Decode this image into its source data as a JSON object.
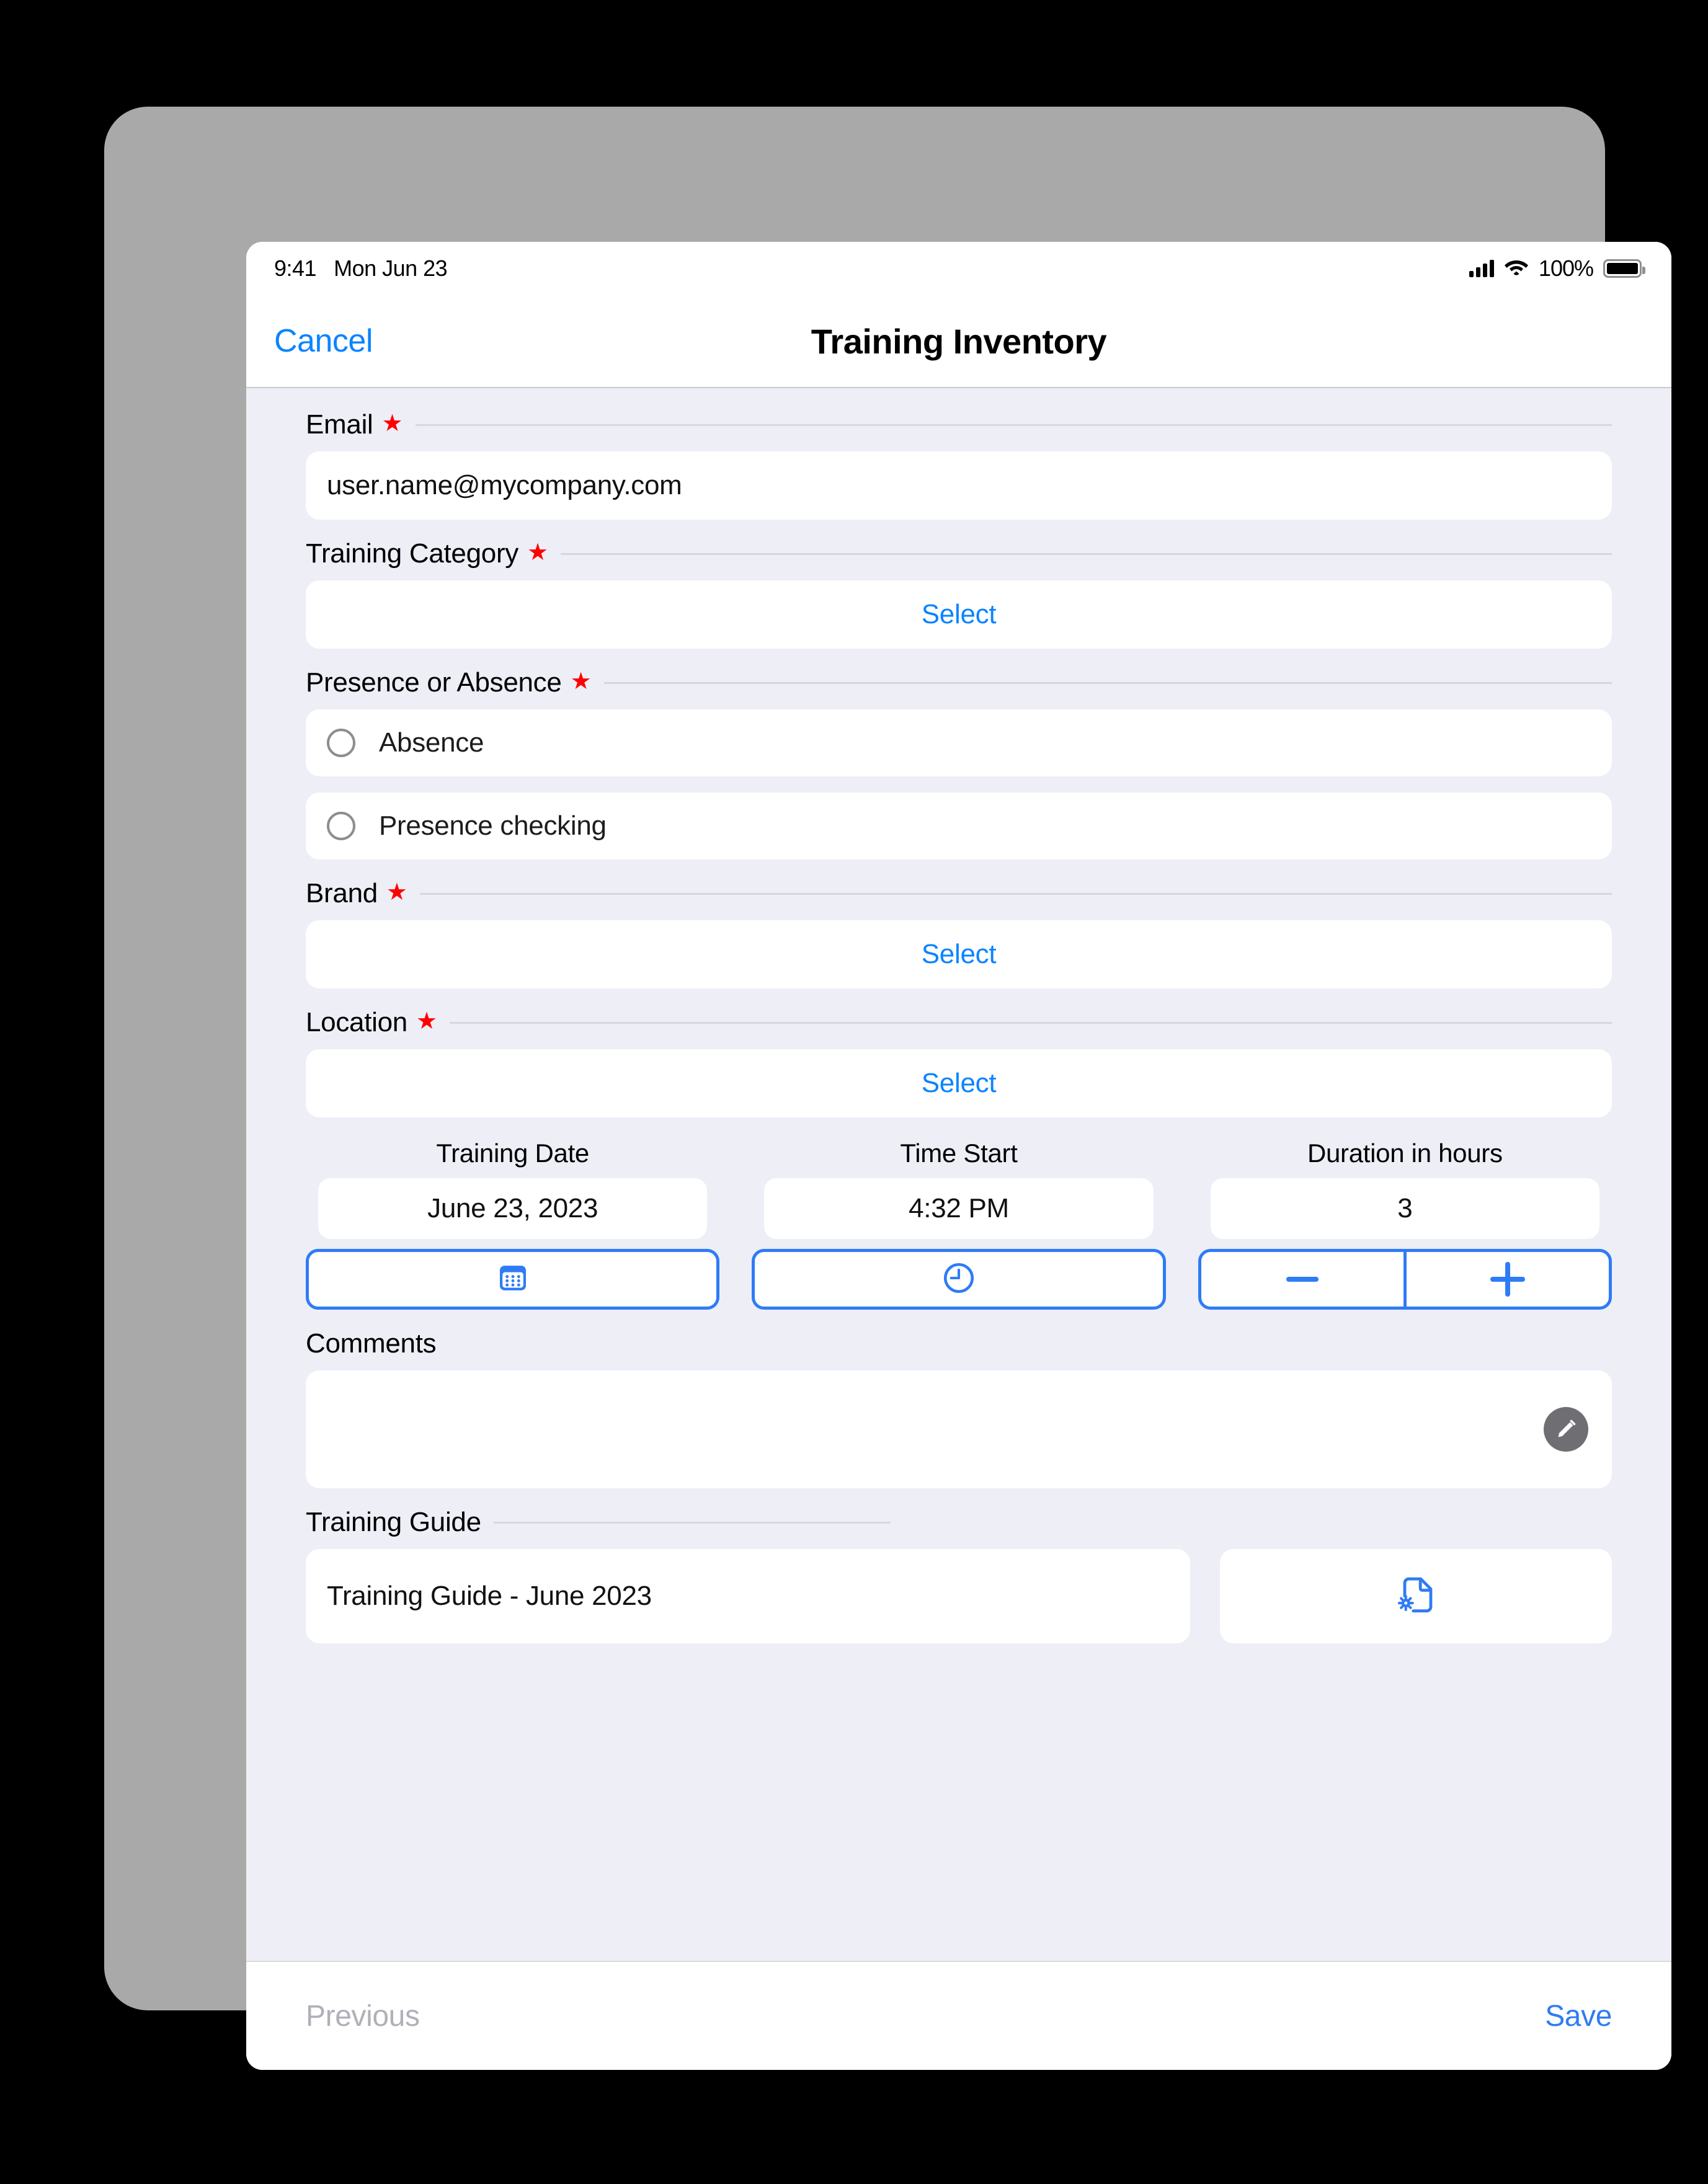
{
  "status_bar": {
    "time": "9:41",
    "date": "Mon Jun 23",
    "battery_percent": "100%",
    "cellular_icon": "signal-bars-icon",
    "wifi_icon": "wifi-icon",
    "battery_icon": "battery-full-icon"
  },
  "nav": {
    "cancel_label": "Cancel",
    "title": "Training Inventory"
  },
  "form": {
    "email": {
      "label": "Email",
      "required_marker": "★",
      "value": "user.name@mycompany.com"
    },
    "training_category": {
      "label": "Training Category",
      "required_marker": "★",
      "value": "Select"
    },
    "presence_or_absence": {
      "label": "Presence or Absence",
      "required_marker": "★",
      "options": [
        {
          "label": "Absence",
          "selected": false
        },
        {
          "label": "Presence checking",
          "selected": false
        }
      ]
    },
    "brand": {
      "label": "Brand",
      "required_marker": "★",
      "value": "Select"
    },
    "location": {
      "label": "Location",
      "required_marker": "★",
      "value": "Select"
    },
    "training_date": {
      "label": "Training Date",
      "value": "June 23, 2023",
      "button_icon": "calendar-icon"
    },
    "time_start": {
      "label": "Time Start",
      "value": "4:32 PM",
      "button_icon": "clock-icon"
    },
    "duration": {
      "label": "Duration in hours",
      "value": "3",
      "decrement_icon": "minus-icon",
      "increment_icon": "plus-icon"
    },
    "comments": {
      "label": "Comments",
      "value": "",
      "edit_icon": "pencil-icon"
    },
    "training_guide": {
      "label": "Training Guide",
      "file_name": "Training Guide - June 2023",
      "button_icon": "document-settings-icon"
    }
  },
  "footer": {
    "previous_label": "Previous",
    "save_label": "Save"
  },
  "colors": {
    "accent_blue": "#0a84ff",
    "button_blue": "#2f7bf6",
    "required_red": "#ff0000",
    "page_background": "#eeeef7",
    "disabled_gray": "#b0b0b8"
  }
}
